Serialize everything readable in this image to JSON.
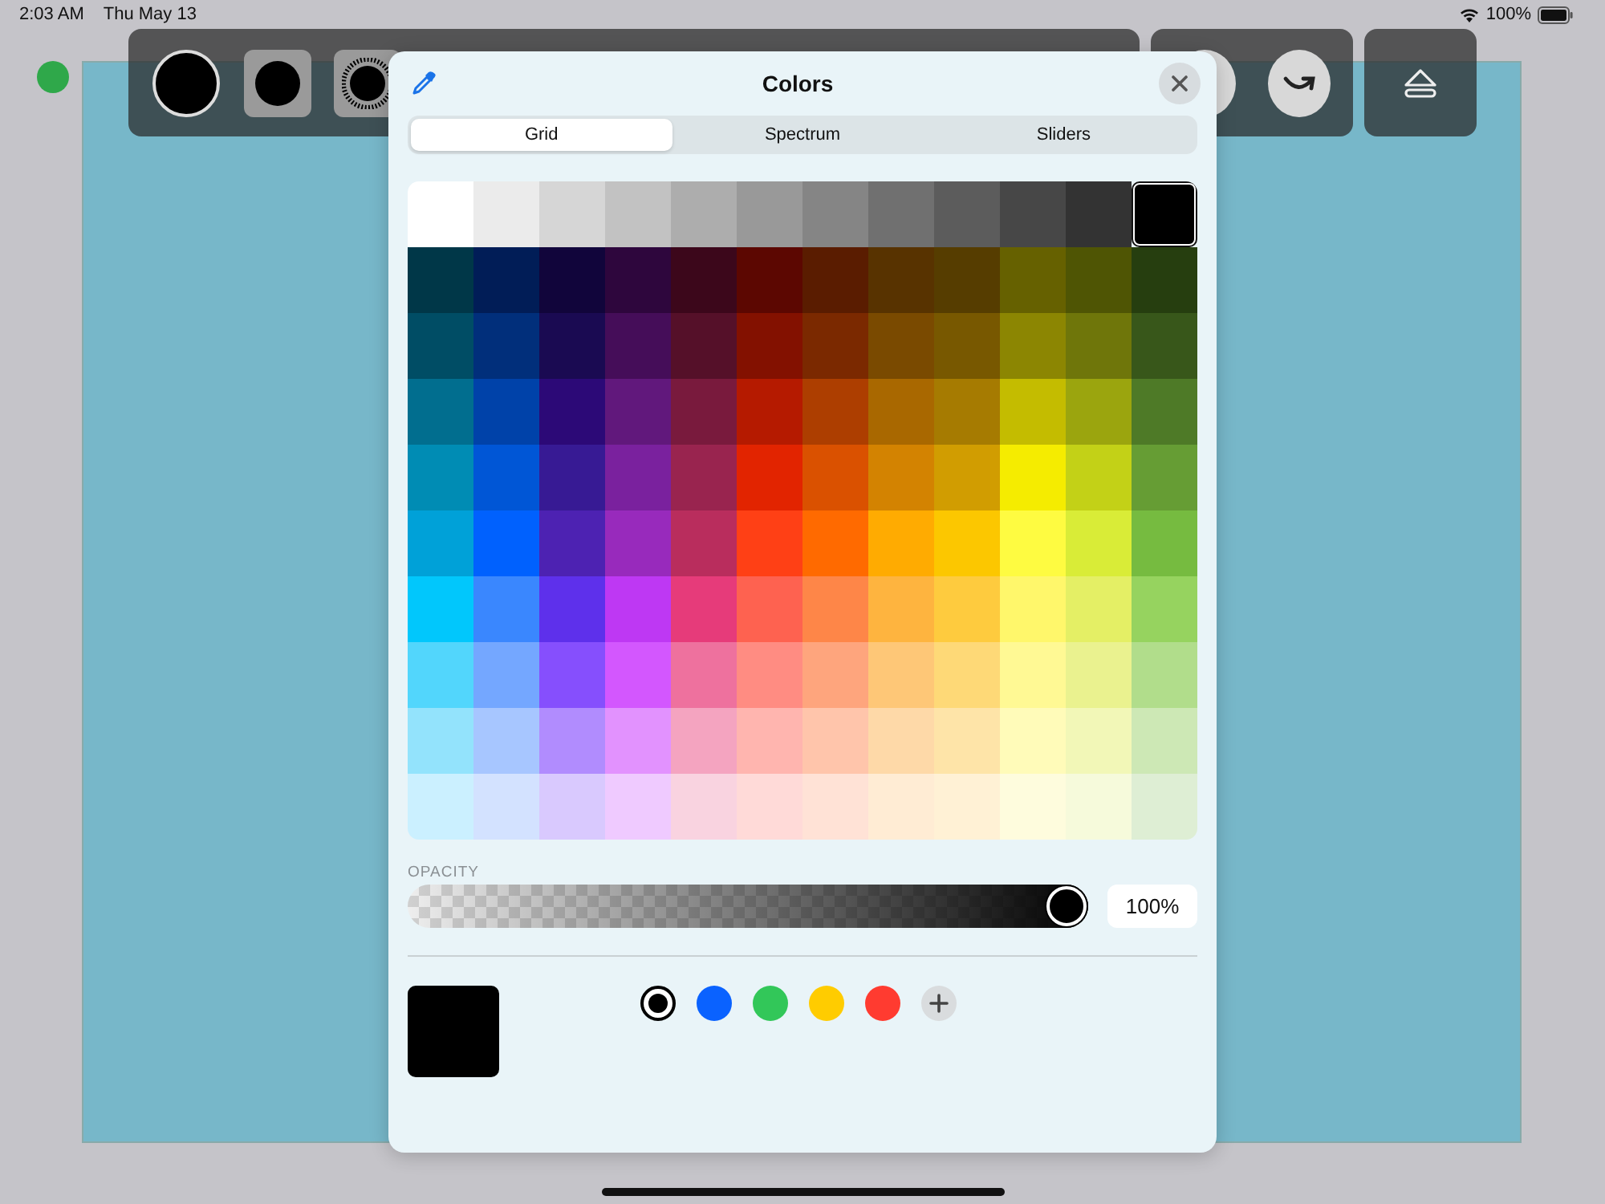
{
  "status_bar": {
    "time": "2:03 AM",
    "date": "Thu May 13",
    "battery": "100%"
  },
  "color_panel": {
    "title": "Colors",
    "tabs": [
      {
        "label": "Grid",
        "selected": true
      },
      {
        "label": "Spectrum",
        "selected": false
      },
      {
        "label": "Sliders",
        "selected": false
      }
    ],
    "grid": [
      {
        "swatches": [
          {
            "color": "#ffffff",
            "selected": false
          },
          {
            "color": "#ebebeb",
            "selected": false
          },
          {
            "color": "#d6d6d6",
            "selected": false
          },
          {
            "color": "#c2c2c2",
            "selected": false
          },
          {
            "color": "#adadad",
            "selected": false
          },
          {
            "color": "#999999",
            "selected": false
          },
          {
            "color": "#858585",
            "selected": false
          },
          {
            "color": "#707070",
            "selected": false
          },
          {
            "color": "#5c5c5c",
            "selected": false
          },
          {
            "color": "#474747",
            "selected": false
          },
          {
            "color": "#333333",
            "selected": false
          },
          {
            "color": "#000000",
            "selected": true
          }
        ]
      },
      {
        "swatches": [
          {
            "color": "#003748",
            "selected": false
          },
          {
            "color": "#011d57",
            "selected": false
          },
          {
            "color": "#11053b",
            "selected": false
          },
          {
            "color": "#2e063d",
            "selected": false
          },
          {
            "color": "#3c071b",
            "selected": false
          },
          {
            "color": "#5c0701",
            "selected": false
          },
          {
            "color": "#5a1c00",
            "selected": false
          },
          {
            "color": "#583300",
            "selected": false
          },
          {
            "color": "#563d00",
            "selected": false
          },
          {
            "color": "#666100",
            "selected": false
          },
          {
            "color": "#4f5504",
            "selected": false
          },
          {
            "color": "#263e0f",
            "selected": false
          }
        ]
      },
      {
        "swatches": [
          {
            "color": "#004d65",
            "selected": false
          },
          {
            "color": "#012f7b",
            "selected": false
          },
          {
            "color": "#1a0a52",
            "selected": false
          },
          {
            "color": "#450d59",
            "selected": false
          },
          {
            "color": "#551029",
            "selected": false
          },
          {
            "color": "#831100",
            "selected": false
          },
          {
            "color": "#7b2900",
            "selected": false
          },
          {
            "color": "#7a4a00",
            "selected": false
          },
          {
            "color": "#785800",
            "selected": false
          },
          {
            "color": "#8c8602",
            "selected": false
          },
          {
            "color": "#6f760a",
            "selected": false
          },
          {
            "color": "#38571a",
            "selected": false
          }
        ]
      },
      {
        "swatches": [
          {
            "color": "#016e8f",
            "selected": false
          },
          {
            "color": "#0042a9",
            "selected": false
          },
          {
            "color": "#2c0977",
            "selected": false
          },
          {
            "color": "#61187c",
            "selected": false
          },
          {
            "color": "#791a3d",
            "selected": false
          },
          {
            "color": "#b51a00",
            "selected": false
          },
          {
            "color": "#ad3e00",
            "selected": false
          },
          {
            "color": "#a96800",
            "selected": false
          },
          {
            "color": "#a67b01",
            "selected": false
          },
          {
            "color": "#c4bc00",
            "selected": false
          },
          {
            "color": "#9ba50e",
            "selected": false
          },
          {
            "color": "#4e7a27",
            "selected": false
          }
        ]
      },
      {
        "swatches": [
          {
            "color": "#008cb4",
            "selected": false
          },
          {
            "color": "#0056d6",
            "selected": false
          },
          {
            "color": "#371a94",
            "selected": false
          },
          {
            "color": "#7a219e",
            "selected": false
          },
          {
            "color": "#99244f",
            "selected": false
          },
          {
            "color": "#e22400",
            "selected": false
          },
          {
            "color": "#da5100",
            "selected": false
          },
          {
            "color": "#d38301",
            "selected": false
          },
          {
            "color": "#d19d01",
            "selected": false
          },
          {
            "color": "#f5ec00",
            "selected": false
          },
          {
            "color": "#c3d117",
            "selected": false
          },
          {
            "color": "#669d34",
            "selected": false
          }
        ]
      },
      {
        "swatches": [
          {
            "color": "#00a1d8",
            "selected": false
          },
          {
            "color": "#0061fe",
            "selected": false
          },
          {
            "color": "#4d22b2",
            "selected": false
          },
          {
            "color": "#982abc",
            "selected": false
          },
          {
            "color": "#b92d5d",
            "selected": false
          },
          {
            "color": "#ff4015",
            "selected": false
          },
          {
            "color": "#ff6a00",
            "selected": false
          },
          {
            "color": "#ffab01",
            "selected": false
          },
          {
            "color": "#fcc700",
            "selected": false
          },
          {
            "color": "#fefb41",
            "selected": false
          },
          {
            "color": "#d9ec37",
            "selected": false
          },
          {
            "color": "#76bb40",
            "selected": false
          }
        ]
      },
      {
        "swatches": [
          {
            "color": "#01c7fc",
            "selected": false
          },
          {
            "color": "#3a87fe",
            "selected": false
          },
          {
            "color": "#5e30eb",
            "selected": false
          },
          {
            "color": "#be38f3",
            "selected": false
          },
          {
            "color": "#e63b7a",
            "selected": false
          },
          {
            "color": "#fe6250",
            "selected": false
          },
          {
            "color": "#fe8648",
            "selected": false
          },
          {
            "color": "#feb43f",
            "selected": false
          },
          {
            "color": "#fecb3e",
            "selected": false
          },
          {
            "color": "#fff76b",
            "selected": false
          },
          {
            "color": "#e4ef65",
            "selected": false
          },
          {
            "color": "#96d35f",
            "selected": false
          }
        ]
      },
      {
        "swatches": [
          {
            "color": "#52d6fc",
            "selected": false
          },
          {
            "color": "#74a7ff",
            "selected": false
          },
          {
            "color": "#864ffd",
            "selected": false
          },
          {
            "color": "#d357fe",
            "selected": false
          },
          {
            "color": "#ee719e",
            "selected": false
          },
          {
            "color": "#ff8c82",
            "selected": false
          },
          {
            "color": "#fea57d",
            "selected": false
          },
          {
            "color": "#fec777",
            "selected": false
          },
          {
            "color": "#fed977",
            "selected": false
          },
          {
            "color": "#fff994",
            "selected": false
          },
          {
            "color": "#eaf28f",
            "selected": false
          },
          {
            "color": "#b1dd8b",
            "selected": false
          }
        ]
      },
      {
        "swatches": [
          {
            "color": "#93e3fc",
            "selected": false
          },
          {
            "color": "#a7c6ff",
            "selected": false
          },
          {
            "color": "#b18cfe",
            "selected": false
          },
          {
            "color": "#e292fe",
            "selected": false
          },
          {
            "color": "#f4a4c0",
            "selected": false
          },
          {
            "color": "#ffb5af",
            "selected": false
          },
          {
            "color": "#ffc5ab",
            "selected": false
          },
          {
            "color": "#fed9a8",
            "selected": false
          },
          {
            "color": "#fee4a8",
            "selected": false
          },
          {
            "color": "#fffbb9",
            "selected": false
          },
          {
            "color": "#f2f7b7",
            "selected": false
          },
          {
            "color": "#cde8b5",
            "selected": false
          }
        ]
      },
      {
        "swatches": [
          {
            "color": "#cbf0ff",
            "selected": false
          },
          {
            "color": "#d3e2ff",
            "selected": false
          },
          {
            "color": "#d9c9fe",
            "selected": false
          },
          {
            "color": "#efcaff",
            "selected": false
          },
          {
            "color": "#f9d3e0",
            "selected": false
          },
          {
            "color": "#ffdad8",
            "selected": false
          },
          {
            "color": "#ffe2d6",
            "selected": false
          },
          {
            "color": "#ffecd4",
            "selected": false
          },
          {
            "color": "#fff1d5",
            "selected": false
          },
          {
            "color": "#fefcdd",
            "selected": false
          },
          {
            "color": "#f6fadb",
            "selected": false
          },
          {
            "color": "#deeed4",
            "selected": false
          }
        ]
      }
    ],
    "opacity": {
      "label": "OPACITY",
      "level": 1,
      "reading": "100%"
    },
    "presets": [
      {
        "color": "#000000",
        "selected": true
      },
      {
        "color": "#0a62ff",
        "selected": false
      },
      {
        "color": "#32c759",
        "selected": false
      },
      {
        "color": "#ffcc00",
        "selected": false
      },
      {
        "color": "#ff3b30",
        "selected": false
      }
    ]
  }
}
